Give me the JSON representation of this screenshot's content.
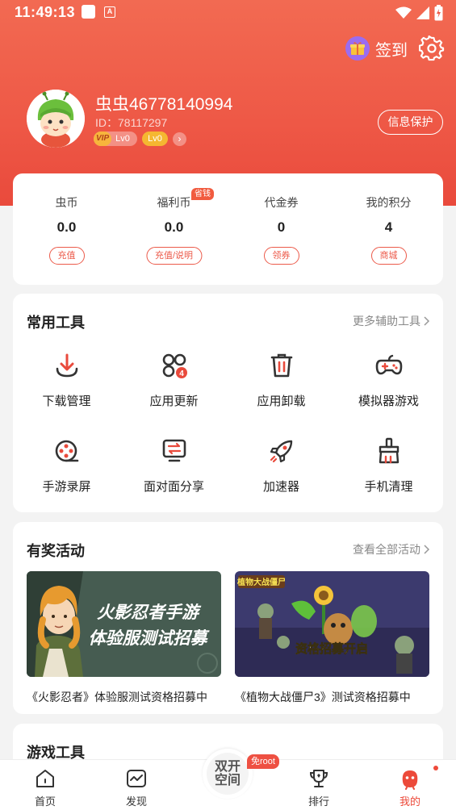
{
  "status_bar": {
    "time": "11:49:13",
    "app_icon_letter": "A"
  },
  "header": {
    "signin_label": "签到",
    "username": "虫虫46778140994",
    "user_id": "ID：78117297",
    "vip_badge": {
      "vip": "VIP",
      "level": "Lv0"
    },
    "level_badge": "Lv0",
    "protect_button": "信息保护"
  },
  "wallet": {
    "items": [
      {
        "label": "虫币",
        "value": "0.0",
        "button": "充值"
      },
      {
        "label": "福利币",
        "value": "0.0",
        "button": "充值/说明",
        "tag": "省钱"
      },
      {
        "label": "代金券",
        "value": "0",
        "button": "领券"
      },
      {
        "label": "我的积分",
        "value": "4",
        "button": "商城"
      }
    ]
  },
  "tools": {
    "title": "常用工具",
    "more": "更多辅助工具",
    "items": [
      {
        "label": "下载管理",
        "icon": "download-icon"
      },
      {
        "label": "应用更新",
        "icon": "app-update-icon",
        "badge": "4"
      },
      {
        "label": "应用卸载",
        "icon": "trash-icon"
      },
      {
        "label": "模拟器游戏",
        "icon": "gamepad-icon"
      },
      {
        "label": "手游录屏",
        "icon": "film-reel-icon"
      },
      {
        "label": "面对面分享",
        "icon": "transfer-icon"
      },
      {
        "label": "加速器",
        "icon": "rocket-icon"
      },
      {
        "label": "手机清理",
        "icon": "broom-icon"
      }
    ]
  },
  "activities": {
    "title": "有奖活动",
    "more": "查看全部活动",
    "items": [
      {
        "caption": "《火影忍者》体验服测试资格招募中",
        "banner_text_line1": "火影忍者手游",
        "banner_text_line2": "体验服测试招募"
      },
      {
        "caption": "《植物大战僵尸3》测试资格招募中",
        "banner_text": "资格招募开启",
        "banner_logo": "植物大战僵尸"
      }
    ]
  },
  "game_tools": {
    "title": "游戏工具"
  },
  "bottom_nav": {
    "items": [
      {
        "label": "首页",
        "icon": "home-icon"
      },
      {
        "label": "发现",
        "icon": "discover-icon"
      },
      {
        "label": "排行",
        "icon": "trophy-icon"
      },
      {
        "label": "我的",
        "icon": "profile-icon"
      }
    ],
    "center_line1": "双开",
    "center_line2": "空间",
    "center_tag": "免root"
  },
  "colors": {
    "accent": "#ec5a4a",
    "header": "#ee5846"
  }
}
